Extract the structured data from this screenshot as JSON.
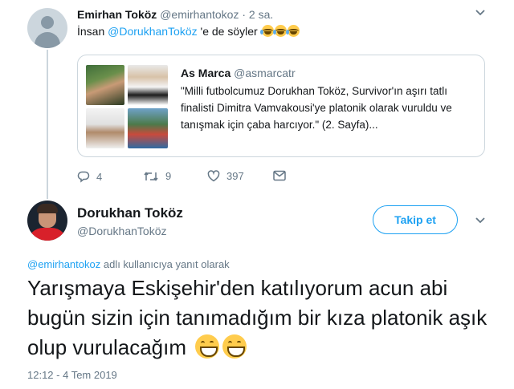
{
  "tweet1": {
    "name": "Emirhan Toköz",
    "handle": "@emirhantokoz",
    "separator": "·",
    "time": "2 sa.",
    "text_prefix": "İnsan ",
    "mention": "@DorukhanToköz",
    "text_suffix": " 'e de söyler",
    "emoji": "face-with-tears-of-joy x3",
    "quote": {
      "name": "As Marca",
      "handle": "@asmarcatr",
      "text": "\"Milli futbolcumuz Dorukhan Toköz, Survivor'ın aşırı tatlı finalisti Dimitra Vamvakousi'ye platonik olarak vuruldu ve tanışmak için çaba harcıyor.\" (2. Sayfa)..."
    },
    "actions": {
      "replies": "4",
      "retweets": "9",
      "likes": "397"
    }
  },
  "tweet2": {
    "name": "Dorukhan Toköz",
    "handle": "@DorukhanToköz",
    "follow_label": "Takip et",
    "reply_mention": "@emirhantokoz",
    "reply_suffix": " adlı kullanıcıya yanıt olarak",
    "text": "Yarışmaya Eskişehir'den katılıyorum acun abi bugün sizin için tanımadığım bir kıza platonik aşık olup vurulacağım",
    "emoji": "grinning-face-with-smiling-eyes x2",
    "timestamp": "12:12 - 4 Tem 2019"
  },
  "colors": {
    "accent": "#1da1f2",
    "secondary_text": "#657786",
    "primary_text": "#14171a",
    "border": "#ccd6dd"
  }
}
